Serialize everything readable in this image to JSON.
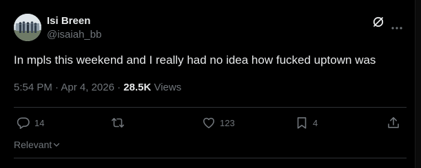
{
  "author": {
    "display_name": "Isi Breen",
    "handle": "@isaiah_bb"
  },
  "post": {
    "text": "In mpls this weekend and I really had no idea how fucked uptown was",
    "time": "5:54 PM",
    "separator_1": " · ",
    "date": "Apr 4, 2026",
    "separator_2": " · ",
    "views_count": "28.5K",
    "views_label": " Views"
  },
  "actions": {
    "replies": "14",
    "reposts": "",
    "likes": "123",
    "bookmarks": "4"
  },
  "sort": {
    "label": "Relevant"
  },
  "icons": {
    "header_right": [
      "grok-icon",
      "more-icon"
    ],
    "action_bar": [
      "reply-icon",
      "repost-icon",
      "like-icon",
      "bookmark-icon",
      "share-icon"
    ],
    "sort": "chevron-down-icon"
  },
  "colors": {
    "background": "#000000",
    "primary_text": "#e7e9ea",
    "secondary_text": "#71767b",
    "divider": "#2f3336"
  }
}
